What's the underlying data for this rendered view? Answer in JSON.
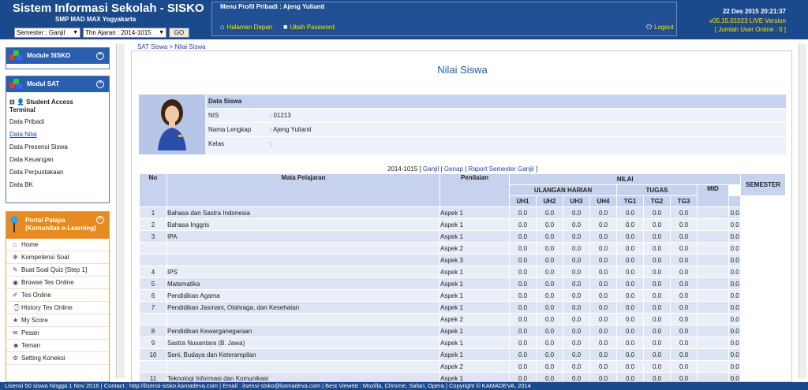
{
  "header": {
    "title": "Sistem Informasi Sekolah - SISKO",
    "subtitle": "SMP MAD MAX Yogyakarta",
    "semester_select": "Semester : Ganjil",
    "year_select": "Thn Ajaran : 2014-1015",
    "go_label": "GO"
  },
  "profile": {
    "title": "Menu Profil Pribadi : Ajeng Yulianti",
    "home_label": "Halaman Depan",
    "password_label": "Ubah Password",
    "logout_label": "Logout"
  },
  "status": {
    "datetime": "22 Des 2015 20:21:37",
    "version": "v05.15.01023 LIVE Version",
    "online": "[ Jumlah User Online : 0 ]"
  },
  "sidebar": {
    "module_sisko": "Module SISKO",
    "module_sat": "Modul SAT",
    "student_access": "Student Access",
    "terminal": "Terminal",
    "links": [
      "Data Pribadi",
      "Data Nilai",
      "Data Presensi Siswa",
      "Data Keuangan",
      "Data Perpustakaan",
      "Data BK"
    ],
    "portal_title": "Portal Palapa",
    "portal_sub": "(Komunitas e-Learning)",
    "portal_items": [
      "Home",
      "Kompetensi Soal",
      "Buat Soal Quiz  [Step 1]",
      "Browse Tes Online",
      "Tes Online",
      "History Tes Online",
      "My Score",
      "Pesan",
      "Teman",
      "Setting Koneksi"
    ]
  },
  "breadcrumb": "SAT Siswa > Nilai Siswa",
  "page_title": "Nilai Siswa",
  "siswa": {
    "heading": "Data Siswa",
    "nis_label": "NIS",
    "nis": ": 01213",
    "nama_label": "Nama Lengkap",
    "nama": ": Ajeng Yulianti",
    "kelas_label": "Kelas",
    "kelas": ":"
  },
  "semester_links": {
    "year": "2014-1015 [",
    "ganjil": "Ganjil",
    "sep1": " | ",
    "genap": "Genap",
    "sep2": " | ",
    "raport": "Raport Semester Ganjil",
    "end": " ]"
  },
  "table": {
    "headers": {
      "no": "No",
      "mapel": "Mata Pelajaran",
      "penilaian": "Penilaian",
      "nilai": "NILAI",
      "ulangan": "ULANGAN HARIAN",
      "tugas": "TUGAS",
      "mid": "MID",
      "semester": "SEMESTER",
      "uh": [
        "UH1",
        "UH2",
        "UH3",
        "UH4"
      ],
      "tg": [
        "TG1",
        "TG2",
        "TG3"
      ]
    },
    "rows": [
      {
        "no": "1",
        "mapel": "Bahasa dan Sastra Indonesia",
        "aspek": "Aspek 1"
      },
      {
        "no": "2",
        "mapel": "Bahasa Inggris",
        "aspek": "Aspek 1"
      },
      {
        "no": "3",
        "mapel": "IPA",
        "aspek": "Aspek 1"
      },
      {
        "no": "",
        "mapel": "",
        "aspek": "Aspek 2"
      },
      {
        "no": "",
        "mapel": "",
        "aspek": "Aspek 3"
      },
      {
        "no": "4",
        "mapel": "IPS",
        "aspek": "Aspek 1"
      },
      {
        "no": "5",
        "mapel": "Matematika",
        "aspek": "Aspek 1"
      },
      {
        "no": "6",
        "mapel": "Pendidikan Agama",
        "aspek": "Aspek 1"
      },
      {
        "no": "7",
        "mapel": "Pendidikan Jasmani, Olahraga, dan Kesehatan",
        "aspek": "Aspek 1"
      },
      {
        "no": "",
        "mapel": "",
        "aspek": "Aspek 2"
      },
      {
        "no": "8",
        "mapel": "Pendidikan Kewarganegaraan",
        "aspek": "Aspek 1"
      },
      {
        "no": "9",
        "mapel": "Sastra Nusantara (B. Jawa)",
        "aspek": "Aspek 1"
      },
      {
        "no": "10",
        "mapel": "Seni, Budaya dan Keterampilan",
        "aspek": "Aspek 1"
      },
      {
        "no": "",
        "mapel": "",
        "aspek": "Aspek 2"
      },
      {
        "no": "11",
        "mapel": "Teknologi Informasi dan Komunikasi",
        "aspek": "Aspek 1"
      }
    ],
    "value": "0.0"
  },
  "footer": "Lisensi 50 siswa hingga 1 Nov 2016   |   Contact : http://lisensi-sisko.kamadeva.com   |   Email : lisensi-sisko@kamadeva.com   |   Best Viewed : Mozilla, Chrome, Safari, Opera   |   Copyright © KAMADEVA, 2014"
}
